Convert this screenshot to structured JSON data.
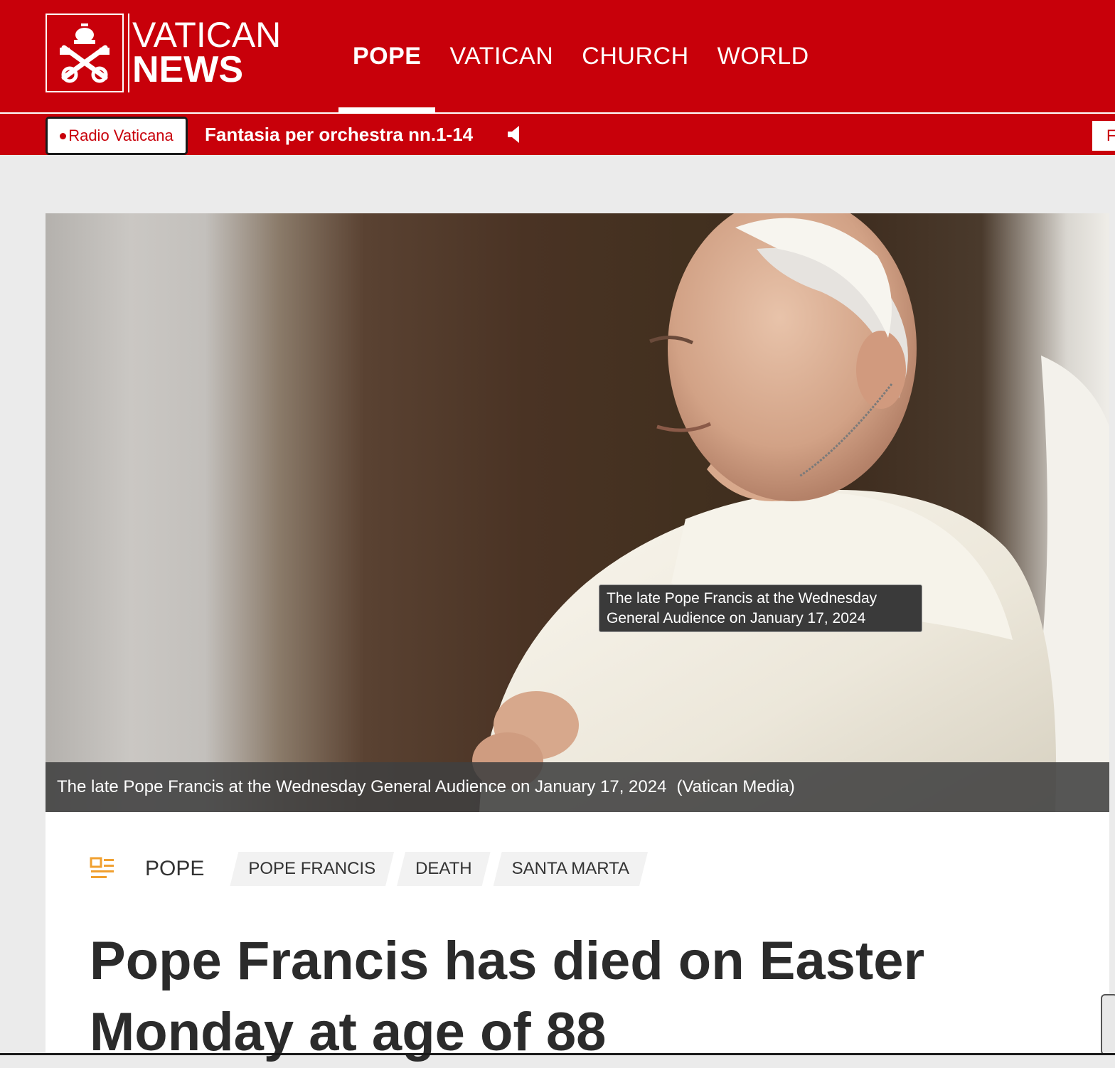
{
  "header": {
    "logo_line1": "VATICAN",
    "logo_line2": "NEWS",
    "nav": [
      {
        "label": "POPE",
        "active": true
      },
      {
        "label": "VATICAN",
        "active": false
      },
      {
        "label": "CHURCH",
        "active": false
      },
      {
        "label": "WORLD",
        "active": false
      }
    ]
  },
  "radio": {
    "station": "Radio Vaticana",
    "now_playing": "Fantasia per orchestra nn.1-14",
    "right_box_text": "F"
  },
  "hero": {
    "tooltip_line1": "The late Pope Francis at the Wednesday",
    "tooltip_line2": "General Audience on January 17, 2024",
    "caption": "The late Pope Francis at the Wednesday General Audience on January 17, 2024",
    "credit": "(Vatican Media)"
  },
  "article": {
    "section": "POPE",
    "tags": [
      "POPE FRANCIS",
      "DEATH",
      "SANTA MARTA"
    ],
    "headline_line1": "Pope Francis has died on Easter",
    "headline_line2": "Monday at age of 88"
  },
  "colors": {
    "brand_red": "#c8000a",
    "section_icon": "#f0a030"
  }
}
